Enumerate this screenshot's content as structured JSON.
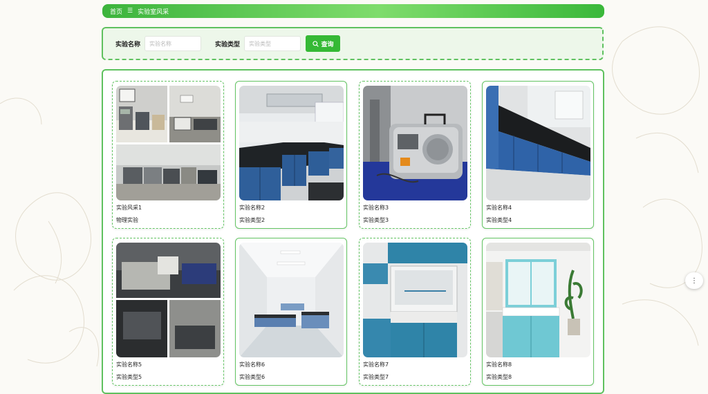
{
  "breadcrumb": {
    "home": "首页",
    "separator": "☰",
    "current": "实验室风采"
  },
  "search": {
    "name_label": "实验名称",
    "name_placeholder": "实验名称",
    "type_label": "实验类型",
    "type_placeholder": "实验类型",
    "button_label": "查询",
    "button_icon": "search-icon"
  },
  "cards": [
    {
      "name": "实验风采1",
      "type": "物理实验"
    },
    {
      "name": "实验名称2",
      "type": "实验类型2"
    },
    {
      "name": "实验名称3",
      "type": "实验类型3"
    },
    {
      "name": "实验名称4",
      "type": "实验类型4"
    },
    {
      "name": "实验名称5",
      "type": "实验类型5"
    },
    {
      "name": "实验名称6",
      "type": "实验类型6"
    },
    {
      "name": "实验名称7",
      "type": "实验类型7"
    },
    {
      "name": "实验名称8",
      "type": "实验类型8"
    }
  ],
  "side_button": {
    "icon": "more-dots-icon",
    "glyph": "⋮"
  },
  "colors": {
    "accent": "#35b935",
    "border": "#5fc15f",
    "panel_bg": "#edf7ea"
  }
}
